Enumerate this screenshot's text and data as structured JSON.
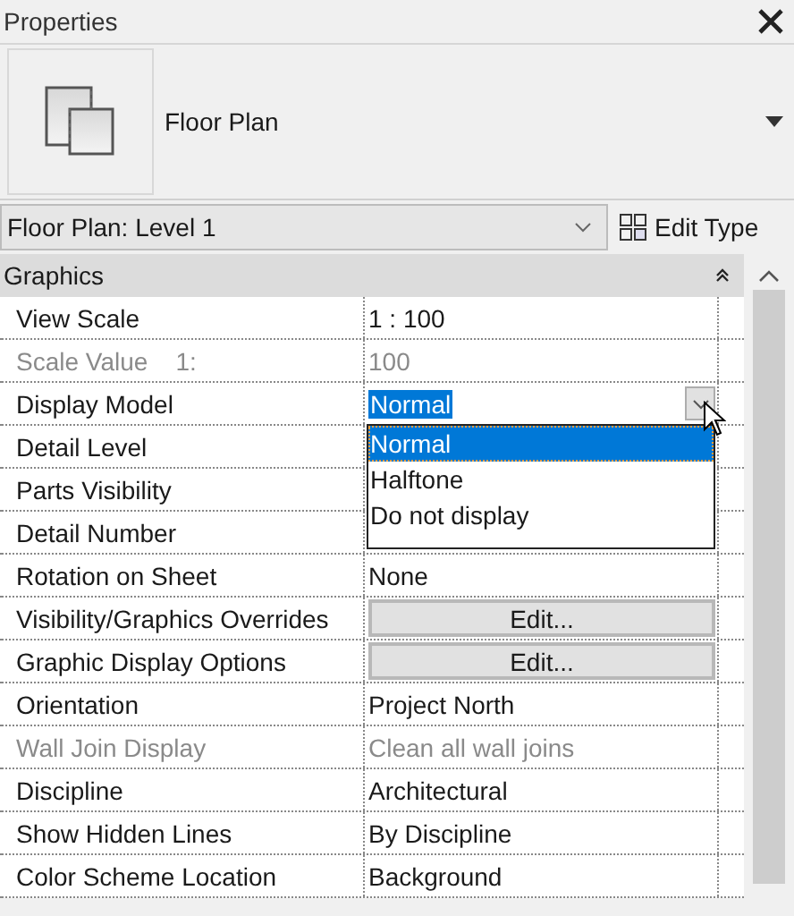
{
  "panel": {
    "title": "Properties"
  },
  "type_selector": {
    "name": "Floor Plan"
  },
  "instance_selector": {
    "value": "Floor Plan: Level 1"
  },
  "edit_type_button": {
    "label": "Edit Type"
  },
  "section": {
    "title": "Graphics",
    "expanded": true
  },
  "rows": [
    {
      "kind": "text",
      "label": "View Scale",
      "value": "1 : 100",
      "disabled": false
    },
    {
      "kind": "text",
      "label": "Scale Value    1:",
      "value": "100",
      "disabled": true
    },
    {
      "kind": "combo",
      "label": "Display Model",
      "value": "Normal",
      "disabled": false,
      "open": true,
      "options": [
        {
          "label": "Normal",
          "selected": true
        },
        {
          "label": "Halftone",
          "selected": false
        },
        {
          "label": "Do not display",
          "selected": false
        }
      ]
    },
    {
      "kind": "text",
      "label": "Detail Level",
      "disabled": false
    },
    {
      "kind": "text",
      "label": "Parts Visibility",
      "disabled": false
    },
    {
      "kind": "text",
      "label": "Detail Number",
      "disabled": false
    },
    {
      "kind": "text",
      "label": "Rotation on Sheet",
      "value": "None",
      "disabled": false
    },
    {
      "kind": "button",
      "label": "Visibility/Graphics Overrides",
      "value": "Edit...",
      "disabled": false
    },
    {
      "kind": "button",
      "label": "Graphic Display Options",
      "value": "Edit...",
      "disabled": false
    },
    {
      "kind": "text",
      "label": "Orientation",
      "value": "Project North",
      "disabled": false
    },
    {
      "kind": "text",
      "label": "Wall Join Display",
      "value": "Clean all wall joins",
      "disabled": true
    },
    {
      "kind": "text",
      "label": "Discipline",
      "value": "Architectural",
      "disabled": false
    },
    {
      "kind": "text",
      "label": "Show Hidden Lines",
      "value": "By Discipline",
      "disabled": false
    },
    {
      "kind": "text",
      "label": "Color Scheme Location",
      "value": "Background",
      "disabled": false
    }
  ]
}
